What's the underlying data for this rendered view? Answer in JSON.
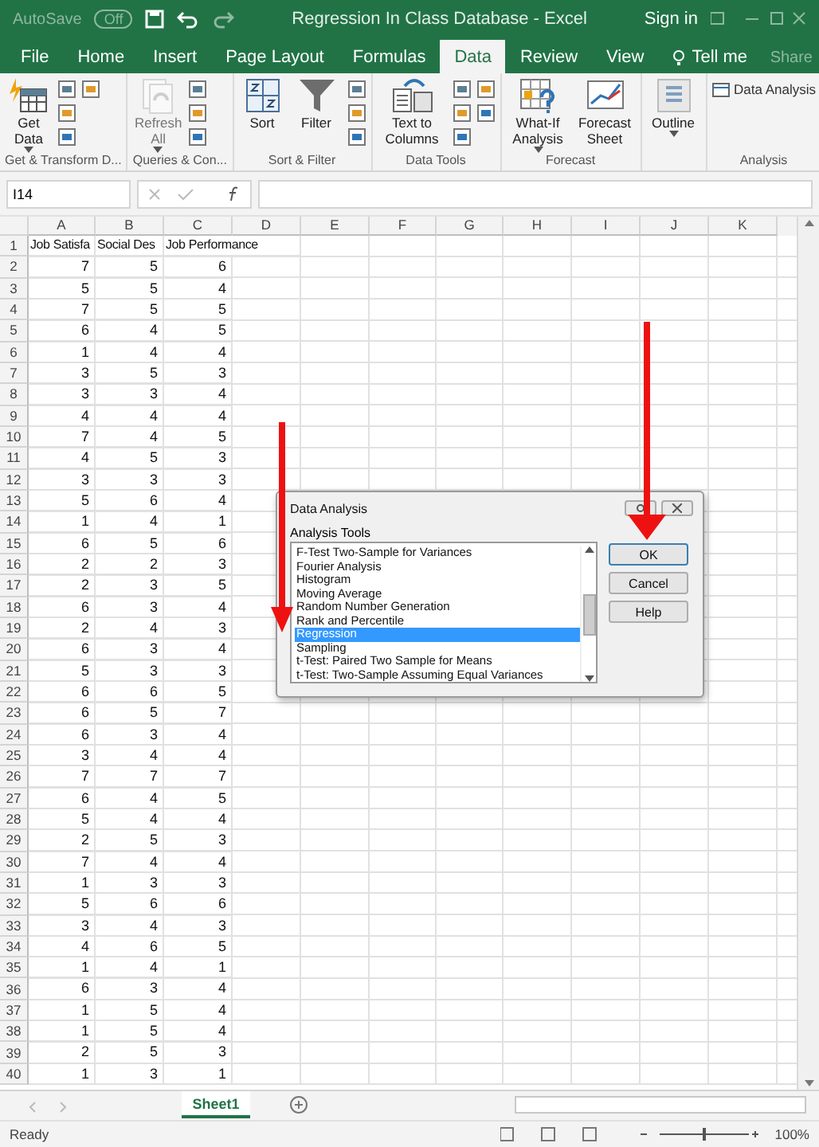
{
  "title_bar": {
    "autosave_label": "AutoSave",
    "autosave_state": "Off",
    "autosave_on": false,
    "title": "Regression In Class Database  -  Excel",
    "sign_in": "Sign in"
  },
  "tabs": [
    {
      "label": "File",
      "selected": false
    },
    {
      "label": "Home",
      "selected": false
    },
    {
      "label": "Insert",
      "selected": false
    },
    {
      "label": "Page Layout",
      "selected": false
    },
    {
      "label": "Formulas",
      "selected": false
    },
    {
      "label": "Data",
      "selected": true
    },
    {
      "label": "Review",
      "selected": false
    },
    {
      "label": "View",
      "selected": false
    }
  ],
  "tell_me": "Tell me",
  "share": "Share",
  "ribbon": [
    {
      "kind": "get",
      "label": "Get & Transform D...",
      "buttons": [
        {
          "kind": "database",
          "label": "Get Data",
          "dropdown": true,
          "disabled": false
        }
      ]
    },
    {
      "kind": "queries",
      "label": "Queries & Con...",
      "buttons": [
        {
          "kind": "refresh",
          "label": "Refresh All",
          "dropdown": true,
          "disabled": true
        }
      ]
    },
    {
      "kind": "sort",
      "label": "Sort & Filter",
      "buttons": [
        {
          "kind": "sort",
          "label": "Sort",
          "dropdown": false,
          "disabled": false
        },
        {
          "kind": "filter",
          "label": "Filter",
          "dropdown": false,
          "disabled": false
        }
      ]
    },
    {
      "kind": "tools",
      "label": "Data Tools",
      "buttons": [
        {
          "kind": "text_columns",
          "label": "Text to Columns",
          "dropdown": false,
          "disabled": false
        }
      ]
    },
    {
      "kind": "forecast",
      "label": "Forecast",
      "buttons": [
        {
          "kind": "what_if",
          "label": "What-If Analysis",
          "dropdown": true,
          "disabled": false
        },
        {
          "kind": "forecast",
          "label": "Forecast Sheet",
          "dropdown": false,
          "disabled": false
        }
      ]
    },
    {
      "kind": "outline",
      "buttons": [
        {
          "kind": "outline",
          "label": "Outline",
          "dropdown": true,
          "disabled": false
        }
      ]
    },
    {
      "kind": "analysis",
      "label": "Analysis",
      "buttons": [
        {
          "kind": "data_analysis",
          "label": "Data Analysis"
        }
      ]
    }
  ],
  "name_box": "I14",
  "columns": [
    "A",
    "B",
    "C",
    "D",
    "E",
    "F",
    "G",
    "H",
    "I",
    "J",
    "K"
  ],
  "rows": [
    {
      "number": "1",
      "cells": [
        "Job Satisfa",
        "Social Des",
        "Job Performance"
      ]
    },
    {
      "number": "2",
      "cells": [
        "7",
        "5",
        "6"
      ]
    },
    {
      "number": "3",
      "cells": [
        "5",
        "5",
        "4"
      ]
    },
    {
      "number": "4",
      "cells": [
        "7",
        "5",
        "5"
      ]
    },
    {
      "number": "5",
      "cells": [
        "6",
        "4",
        "5"
      ]
    },
    {
      "number": "6",
      "cells": [
        "1",
        "4",
        "4"
      ]
    },
    {
      "number": "7",
      "cells": [
        "3",
        "5",
        "3"
      ]
    },
    {
      "number": "8",
      "cells": [
        "3",
        "3",
        "4"
      ]
    },
    {
      "number": "9",
      "cells": [
        "4",
        "4",
        "4"
      ]
    },
    {
      "number": "10",
      "cells": [
        "7",
        "4",
        "5"
      ]
    },
    {
      "number": "11",
      "cells": [
        "4",
        "5",
        "3"
      ]
    },
    {
      "number": "12",
      "cells": [
        "3",
        "3",
        "3"
      ]
    },
    {
      "number": "13",
      "cells": [
        "5",
        "6",
        "4"
      ]
    },
    {
      "number": "14",
      "cells": [
        "1",
        "4",
        "1"
      ]
    },
    {
      "number": "15",
      "cells": [
        "6",
        "5",
        "6"
      ]
    },
    {
      "number": "16",
      "cells": [
        "2",
        "2",
        "3"
      ]
    },
    {
      "number": "17",
      "cells": [
        "2",
        "3",
        "5"
      ]
    },
    {
      "number": "18",
      "cells": [
        "6",
        "3",
        "4"
      ]
    },
    {
      "number": "19",
      "cells": [
        "2",
        "4",
        "3"
      ]
    },
    {
      "number": "20",
      "cells": [
        "6",
        "3",
        "4"
      ]
    },
    {
      "number": "21",
      "cells": [
        "5",
        "3",
        "3"
      ]
    },
    {
      "number": "22",
      "cells": [
        "6",
        "6",
        "5"
      ]
    },
    {
      "number": "23",
      "cells": [
        "6",
        "5",
        "7"
      ]
    },
    {
      "number": "24",
      "cells": [
        "6",
        "3",
        "4"
      ]
    },
    {
      "number": "25",
      "cells": [
        "3",
        "4",
        "4"
      ]
    },
    {
      "number": "26",
      "cells": [
        "7",
        "7",
        "7"
      ]
    },
    {
      "number": "27",
      "cells": [
        "6",
        "4",
        "5"
      ]
    },
    {
      "number": "28",
      "cells": [
        "5",
        "4",
        "4"
      ]
    },
    {
      "number": "29",
      "cells": [
        "2",
        "5",
        "3"
      ]
    },
    {
      "number": "30",
      "cells": [
        "7",
        "4",
        "4"
      ]
    },
    {
      "number": "31",
      "cells": [
        "1",
        "3",
        "3"
      ]
    },
    {
      "number": "32",
      "cells": [
        "5",
        "6",
        "6"
      ]
    },
    {
      "number": "33",
      "cells": [
        "3",
        "4",
        "3"
      ]
    },
    {
      "number": "34",
      "cells": [
        "4",
        "6",
        "5"
      ]
    },
    {
      "number": "35",
      "cells": [
        "1",
        "4",
        "1"
      ]
    },
    {
      "number": "36",
      "cells": [
        "6",
        "3",
        "4"
      ]
    },
    {
      "number": "37",
      "cells": [
        "1",
        "5",
        "4"
      ]
    },
    {
      "number": "38",
      "cells": [
        "1",
        "5",
        "4"
      ]
    },
    {
      "number": "39",
      "cells": [
        "2",
        "5",
        "3"
      ]
    },
    {
      "number": "40",
      "cells": [
        "1",
        "3",
        "1"
      ]
    }
  ],
  "dialog": {
    "title": "Data Analysis",
    "list_label": "Analysis Tools",
    "items": [
      {
        "label": "F-Test Two-Sample for Variances",
        "selected": false
      },
      {
        "label": "Fourier Analysis",
        "selected": false
      },
      {
        "label": "Histogram",
        "selected": false
      },
      {
        "label": "Moving Average",
        "selected": false
      },
      {
        "label": "Random Number Generation",
        "selected": false
      },
      {
        "label": "Rank and Percentile",
        "selected": false
      },
      {
        "label": "Regression",
        "selected": true
      },
      {
        "label": "Sampling",
        "selected": false
      },
      {
        "label": "t-Test: Paired Two Sample for Means",
        "selected": false
      },
      {
        "label": "t-Test: Two-Sample Assuming Equal Variances",
        "selected": false
      }
    ],
    "buttons": [
      {
        "label": "OK",
        "default": true
      },
      {
        "label": "Cancel",
        "default": false
      },
      {
        "label": "Help",
        "default": false
      }
    ]
  },
  "sheets": [
    {
      "label": "Sheet1",
      "selected": true
    }
  ],
  "status": "Ready",
  "zoom": "100%",
  "zoom_slider": {
    "level": 0.5
  }
}
